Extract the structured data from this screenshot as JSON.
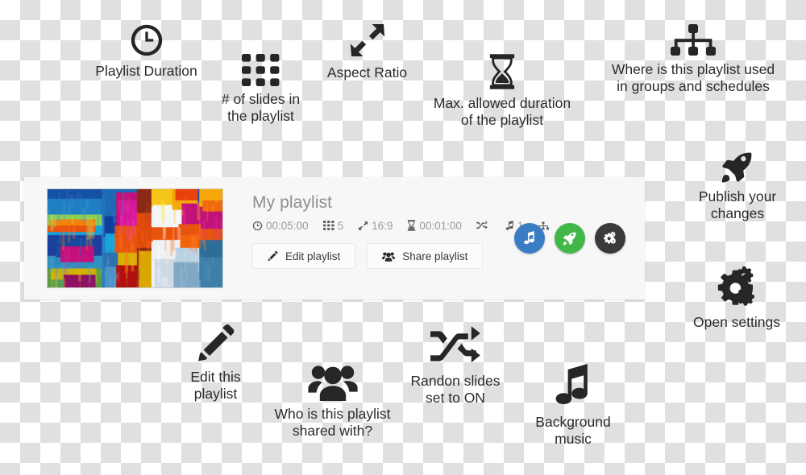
{
  "annotations": [
    {
      "key": "playlist-duration",
      "icon": "clock-icon",
      "caption": "Playlist Duration"
    },
    {
      "key": "slide-count",
      "icon": "grid-icon",
      "caption": "# of slides in\nthe playlist"
    },
    {
      "key": "aspect-ratio",
      "icon": "expand-arrows-icon",
      "caption": "Aspect Ratio"
    },
    {
      "key": "max-duration",
      "icon": "hourglass-icon",
      "caption": "Max. allowed duration\nof the playlist"
    },
    {
      "key": "playlist-usage",
      "icon": "sitemap-icon",
      "caption": "Where is this playlist used\nin groups and schedules"
    },
    {
      "key": "publish-changes",
      "icon": "rocket-icon",
      "caption": "Publish your\nchanges"
    },
    {
      "key": "open-settings",
      "icon": "gears-icon",
      "caption": "Open settings"
    },
    {
      "key": "edit-playlist",
      "icon": "pencil-icon",
      "caption": "Edit this\nplaylist"
    },
    {
      "key": "shared-with",
      "icon": "users-icon",
      "caption": "Who is this playlist\nshared with?"
    },
    {
      "key": "random-slides",
      "icon": "shuffle-icon",
      "caption": "Randon slides\nset to ON"
    },
    {
      "key": "background-music",
      "icon": "music-note-icon",
      "caption": "Background\nmusic"
    }
  ],
  "card": {
    "title": "My playlist",
    "thumbnail_alt": "abstract colorful painting",
    "meta": [
      {
        "icon": "clock-icon",
        "value": "00:05:00"
      },
      {
        "icon": "grid-icon",
        "value": "5"
      },
      {
        "icon": "aspect-icon",
        "value": "16:9"
      },
      {
        "icon": "hourglass-icon",
        "value": "00:01:00"
      },
      {
        "icon": "shuffle-icon",
        "value": ""
      },
      {
        "icon": "music-note-icon",
        "value": "1"
      },
      {
        "icon": "sitemap-icon",
        "value": ""
      }
    ],
    "buttons": [
      {
        "key": "edit-playlist",
        "icon": "pencil-icon",
        "label": "Edit playlist"
      },
      {
        "key": "share-playlist",
        "icon": "users-icon",
        "label": "Share playlist"
      }
    ],
    "round_buttons": [
      {
        "key": "music",
        "icon": "music-note-icon",
        "color": "#3b7dc4"
      },
      {
        "key": "publish",
        "icon": "rocket-icon",
        "color": "#41b748"
      },
      {
        "key": "settings",
        "icon": "gears-icon",
        "color": "#3a3a3a"
      }
    ]
  },
  "colors": {
    "checker_light": "#ffffff",
    "checker_dark": "#e0e0e0",
    "card_bg": "#f7f7f7",
    "title_gray": "#8e8e8e",
    "meta_gray": "#9a9a9a",
    "annotation_text": "#2b2b2b",
    "blue": "#3b7dc4",
    "green": "#41b748",
    "dark": "#3a3a3a"
  }
}
